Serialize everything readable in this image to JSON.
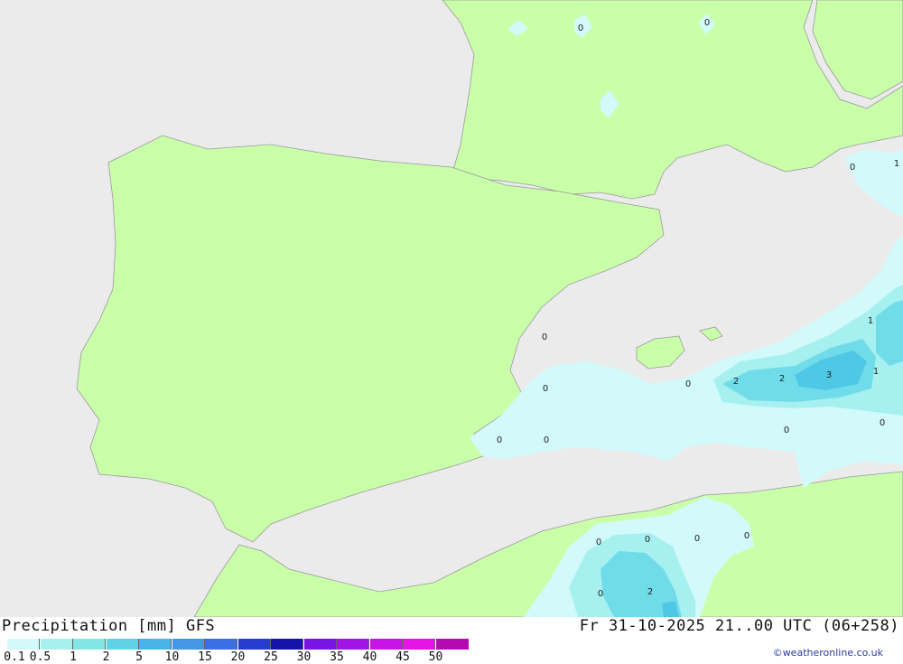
{
  "map": {
    "colors": {
      "sea": "#ebebeb",
      "land": "#caffaa",
      "border": "#999999",
      "precip_low": "#d2fafa",
      "precip_mid": "#a6f0f0",
      "precip_high": "#70dcea",
      "precip_max": "#4fc8e6"
    },
    "value_labels": [
      "0",
      "0",
      "0",
      "1",
      "0",
      "1",
      "0",
      "2",
      "2",
      "3",
      "1",
      "0",
      "0",
      "0",
      "0",
      "0",
      "0",
      "0",
      "0",
      "0",
      "0",
      "2"
    ]
  },
  "footer": {
    "title": "Precipitation [mm] GFS",
    "datetime": "Fr 31-10-2025 21..00 UTC (06+258)",
    "copyright": "©weatheronline.co.uk",
    "legend": {
      "labels": [
        "0.1",
        "0.5",
        "1",
        "2",
        "5",
        "10",
        "15",
        "20",
        "25",
        "30",
        "35",
        "40",
        "45",
        "50"
      ],
      "colors": [
        "#d2fafa",
        "#a6f0f0",
        "#82e6e6",
        "#5fd2e6",
        "#46b4e6",
        "#4696e6",
        "#3c6ee6",
        "#283cd2",
        "#1414aa",
        "#7814e6",
        "#a014e6",
        "#c814e6",
        "#e614e6",
        "#b40ab4"
      ]
    }
  }
}
